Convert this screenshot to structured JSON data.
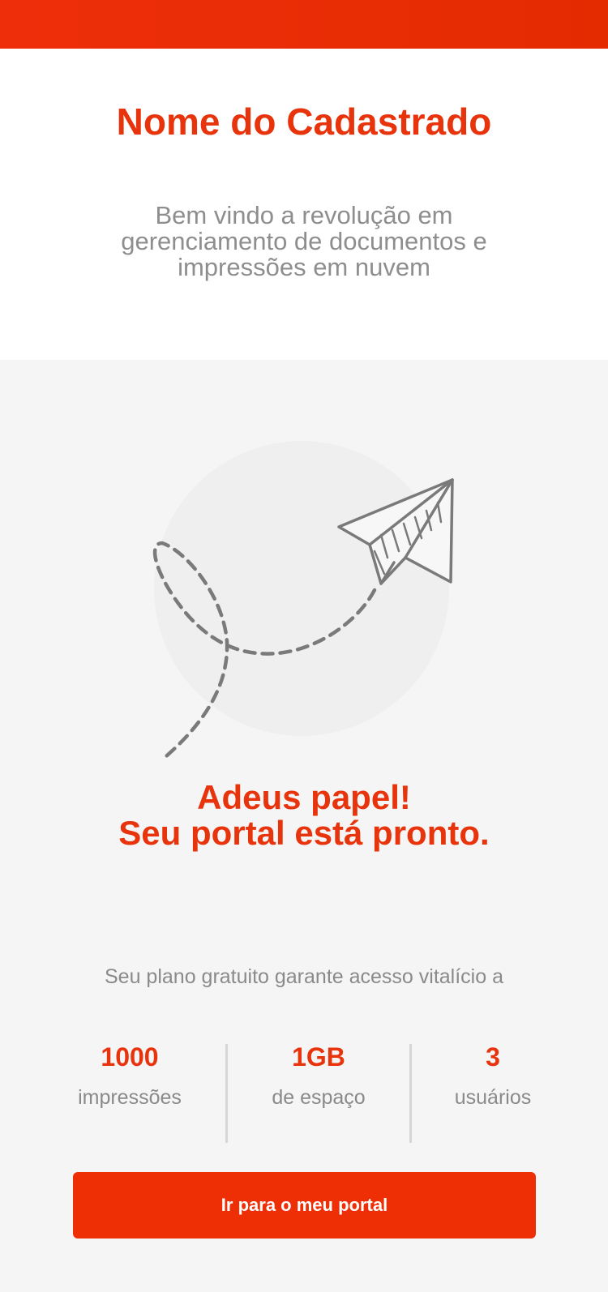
{
  "header": {
    "title": "Nome do Cadastrado",
    "subtitle": "Bem vindo a revolução em gerenciamento de documentos e impressões em nuvem"
  },
  "hero": {
    "illustration_icon": "paper-plane-icon",
    "headline_line1": "Adeus papel!",
    "headline_line2": "Seu portal está pronto."
  },
  "plan": {
    "intro": "Seu plano gratuito garante acesso vitalício a",
    "stats": [
      {
        "value": "1000",
        "label": "impressões"
      },
      {
        "value": "1GB",
        "label": "de espaço"
      },
      {
        "value": "3",
        "label": "usuários"
      }
    ]
  },
  "cta": {
    "label": "Ir para o meu portal"
  },
  "colors": {
    "brand": "#e8340c",
    "topbar": "#e92d06",
    "text_muted": "#8a8a8a",
    "background": "#f5f5f5"
  }
}
